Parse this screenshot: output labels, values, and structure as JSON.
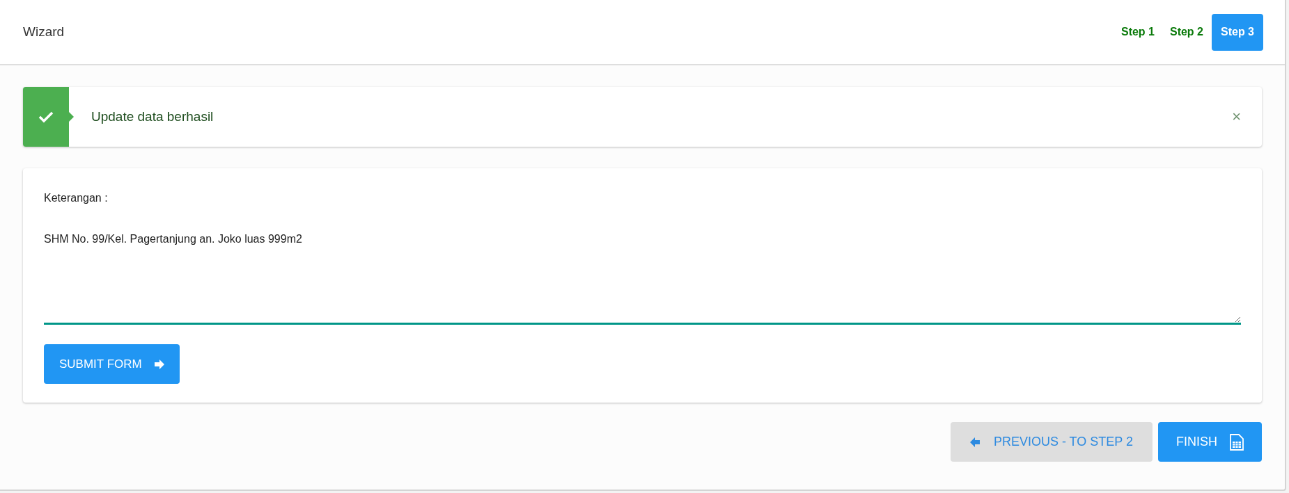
{
  "header": {
    "title": "Wizard"
  },
  "steps": [
    {
      "label": "Step 1",
      "selected": false
    },
    {
      "label": "Step 2",
      "selected": false
    },
    {
      "label": "Step 3",
      "selected": true
    }
  ],
  "alert": {
    "message": "Update data berhasil",
    "close": "×"
  },
  "form": {
    "label": "Keterangan :",
    "value": "SHM No. 99/Kel. Pagertanjung an. Joko luas 999m2",
    "submit": "SUBMIT FORM"
  },
  "footer": {
    "previous": "PREVIOUS - TO STEP 2",
    "finish": "FINISH"
  }
}
